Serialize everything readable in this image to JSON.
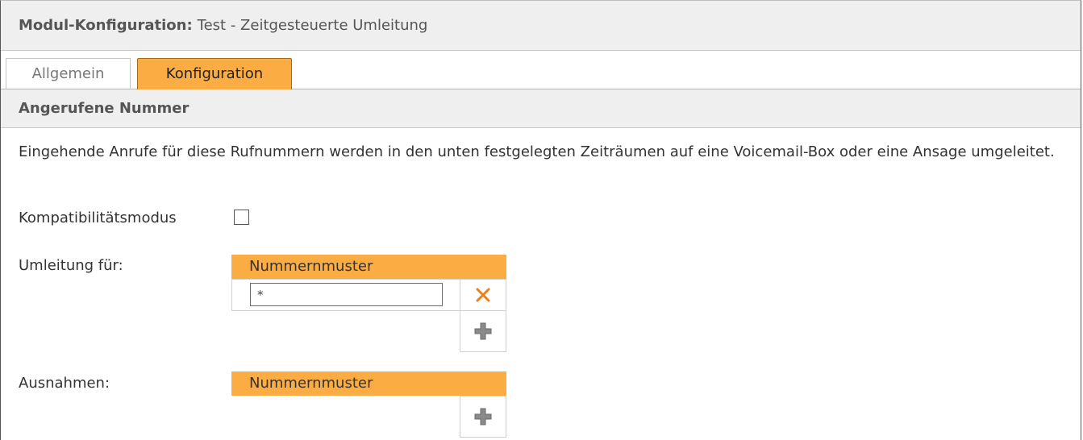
{
  "title": {
    "label": "Modul-Konfiguration:",
    "value": "Test - Zeitgesteuerte Umleitung"
  },
  "tabs": [
    {
      "label": "Allgemein",
      "active": false
    },
    {
      "label": "Konfiguration",
      "active": true
    }
  ],
  "section": {
    "title": "Angerufene Nummer"
  },
  "description": "Eingehende Anrufe für diese Rufnummern werden in den unten festgelegten Zeiträumen auf eine Voicemail-Box oder eine Ansage umgeleitet.",
  "compat": {
    "label": "Kompatibilitätsmodus",
    "checked": false
  },
  "redirect": {
    "label": "Umleitung für:",
    "column_header": "Nummernmuster",
    "rows": [
      {
        "value": "*"
      }
    ]
  },
  "exceptions": {
    "label": "Ausnahmen:",
    "column_header": "Nummernmuster",
    "rows": []
  },
  "colors": {
    "accent": "#fbad43",
    "delete_icon": "#f07c1a",
    "add_icon": "#8a8a8a"
  },
  "icons": {
    "delete": "close-icon",
    "add": "plus-icon"
  }
}
